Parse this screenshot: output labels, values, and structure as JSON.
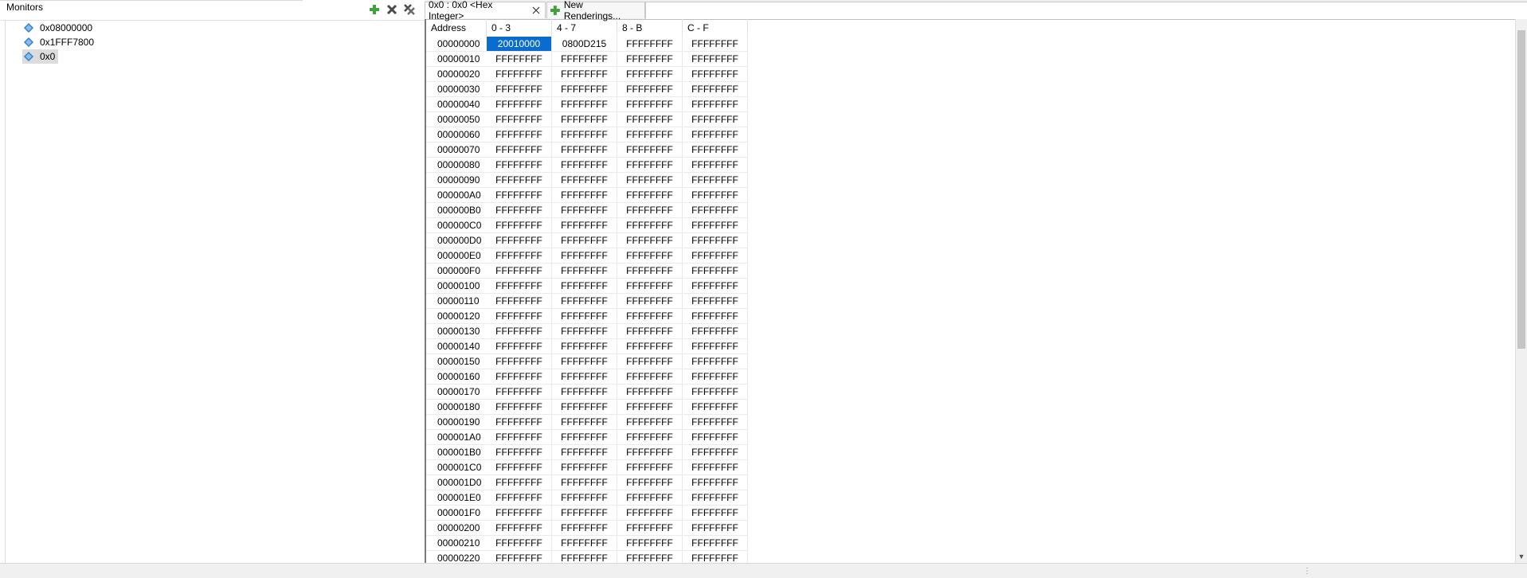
{
  "monitors": {
    "title": "Monitors",
    "tools": [
      "add-monitor-icon",
      "remove-monitor-icon",
      "remove-all-monitors-icon"
    ],
    "items": [
      {
        "label": "0x08000000",
        "selected": false
      },
      {
        "label": "0x1FFF7800",
        "selected": false
      },
      {
        "label": "0x0",
        "selected": true
      }
    ]
  },
  "tabs": {
    "active_label": "0x0 : 0x0 <Hex Integer>",
    "new_rendering_label": "New Renderings..."
  },
  "grid": {
    "headers": [
      "Address",
      "0 - 3",
      "4 - 7",
      "8 - B",
      "C - F"
    ],
    "rows": [
      [
        "00000000",
        "20010000",
        "0800D215",
        "FFFFFFFF",
        "FFFFFFFF"
      ],
      [
        "00000010",
        "FFFFFFFF",
        "FFFFFFFF",
        "FFFFFFFF",
        "FFFFFFFF"
      ],
      [
        "00000020",
        "FFFFFFFF",
        "FFFFFFFF",
        "FFFFFFFF",
        "FFFFFFFF"
      ],
      [
        "00000030",
        "FFFFFFFF",
        "FFFFFFFF",
        "FFFFFFFF",
        "FFFFFFFF"
      ],
      [
        "00000040",
        "FFFFFFFF",
        "FFFFFFFF",
        "FFFFFFFF",
        "FFFFFFFF"
      ],
      [
        "00000050",
        "FFFFFFFF",
        "FFFFFFFF",
        "FFFFFFFF",
        "FFFFFFFF"
      ],
      [
        "00000060",
        "FFFFFFFF",
        "FFFFFFFF",
        "FFFFFFFF",
        "FFFFFFFF"
      ],
      [
        "00000070",
        "FFFFFFFF",
        "FFFFFFFF",
        "FFFFFFFF",
        "FFFFFFFF"
      ],
      [
        "00000080",
        "FFFFFFFF",
        "FFFFFFFF",
        "FFFFFFFF",
        "FFFFFFFF"
      ],
      [
        "00000090",
        "FFFFFFFF",
        "FFFFFFFF",
        "FFFFFFFF",
        "FFFFFFFF"
      ],
      [
        "000000A0",
        "FFFFFFFF",
        "FFFFFFFF",
        "FFFFFFFF",
        "FFFFFFFF"
      ],
      [
        "000000B0",
        "FFFFFFFF",
        "FFFFFFFF",
        "FFFFFFFF",
        "FFFFFFFF"
      ],
      [
        "000000C0",
        "FFFFFFFF",
        "FFFFFFFF",
        "FFFFFFFF",
        "FFFFFFFF"
      ],
      [
        "000000D0",
        "FFFFFFFF",
        "FFFFFFFF",
        "FFFFFFFF",
        "FFFFFFFF"
      ],
      [
        "000000E0",
        "FFFFFFFF",
        "FFFFFFFF",
        "FFFFFFFF",
        "FFFFFFFF"
      ],
      [
        "000000F0",
        "FFFFFFFF",
        "FFFFFFFF",
        "FFFFFFFF",
        "FFFFFFFF"
      ],
      [
        "00000100",
        "FFFFFFFF",
        "FFFFFFFF",
        "FFFFFFFF",
        "FFFFFFFF"
      ],
      [
        "00000110",
        "FFFFFFFF",
        "FFFFFFFF",
        "FFFFFFFF",
        "FFFFFFFF"
      ],
      [
        "00000120",
        "FFFFFFFF",
        "FFFFFFFF",
        "FFFFFFFF",
        "FFFFFFFF"
      ],
      [
        "00000130",
        "FFFFFFFF",
        "FFFFFFFF",
        "FFFFFFFF",
        "FFFFFFFF"
      ],
      [
        "00000140",
        "FFFFFFFF",
        "FFFFFFFF",
        "FFFFFFFF",
        "FFFFFFFF"
      ],
      [
        "00000150",
        "FFFFFFFF",
        "FFFFFFFF",
        "FFFFFFFF",
        "FFFFFFFF"
      ],
      [
        "00000160",
        "FFFFFFFF",
        "FFFFFFFF",
        "FFFFFFFF",
        "FFFFFFFF"
      ],
      [
        "00000170",
        "FFFFFFFF",
        "FFFFFFFF",
        "FFFFFFFF",
        "FFFFFFFF"
      ],
      [
        "00000180",
        "FFFFFFFF",
        "FFFFFFFF",
        "FFFFFFFF",
        "FFFFFFFF"
      ],
      [
        "00000190",
        "FFFFFFFF",
        "FFFFFFFF",
        "FFFFFFFF",
        "FFFFFFFF"
      ],
      [
        "000001A0",
        "FFFFFFFF",
        "FFFFFFFF",
        "FFFFFFFF",
        "FFFFFFFF"
      ],
      [
        "000001B0",
        "FFFFFFFF",
        "FFFFFFFF",
        "FFFFFFFF",
        "FFFFFFFF"
      ],
      [
        "000001C0",
        "FFFFFFFF",
        "FFFFFFFF",
        "FFFFFFFF",
        "FFFFFFFF"
      ],
      [
        "000001D0",
        "FFFFFFFF",
        "FFFFFFFF",
        "FFFFFFFF",
        "FFFFFFFF"
      ],
      [
        "000001E0",
        "FFFFFFFF",
        "FFFFFFFF",
        "FFFFFFFF",
        "FFFFFFFF"
      ],
      [
        "000001F0",
        "FFFFFFFF",
        "FFFFFFFF",
        "FFFFFFFF",
        "FFFFFFFF"
      ],
      [
        "00000200",
        "FFFFFFFF",
        "FFFFFFFF",
        "FFFFFFFF",
        "FFFFFFFF"
      ],
      [
        "00000210",
        "FFFFFFFF",
        "FFFFFFFF",
        "FFFFFFFF",
        "FFFFFFFF"
      ],
      [
        "00000220",
        "FFFFFFFF",
        "FFFFFFFF",
        "FFFFFFFF",
        "FFFFFFFF"
      ]
    ],
    "selected_cell": {
      "row": 0,
      "col": 1
    }
  },
  "colors": {
    "selection": "#0a6cd1",
    "add_icon": "#3fa33a",
    "remove_icon": "#4a4a4a",
    "monitor_icon": "#2f80c9"
  }
}
